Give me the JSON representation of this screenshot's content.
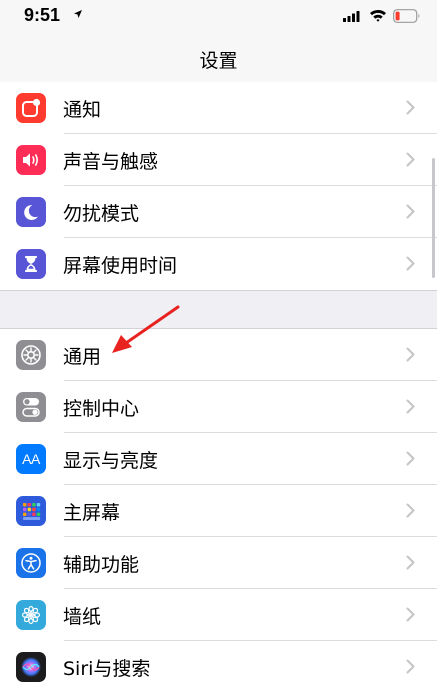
{
  "status_bar": {
    "time": "9:51"
  },
  "nav": {
    "title": "设置"
  },
  "groups": [
    {
      "items": [
        {
          "label": "通知",
          "icon": "notifications-icon",
          "color": "#ff3b30"
        },
        {
          "label": "声音与触感",
          "icon": "sound-icon",
          "color": "#ff2d55"
        },
        {
          "label": "勿扰模式",
          "icon": "moon-icon",
          "color": "#5856d6"
        },
        {
          "label": "屏幕使用时间",
          "icon": "hourglass-icon",
          "color": "#5856d6"
        }
      ]
    },
    {
      "items": [
        {
          "label": "通用",
          "icon": "gear-icon",
          "color": "#8e8e93"
        },
        {
          "label": "控制中心",
          "icon": "toggles-icon",
          "color": "#8e8e93"
        },
        {
          "label": "显示与亮度",
          "icon": "text-size-icon",
          "color": "#007aff"
        },
        {
          "label": "主屏幕",
          "icon": "home-grid-icon",
          "color": "#2d5bdc"
        },
        {
          "label": "辅助功能",
          "icon": "accessibility-icon",
          "color": "#1a73e8"
        },
        {
          "label": "墙纸",
          "icon": "flower-icon",
          "color": "#34aadc"
        },
        {
          "label": "Siri与搜索",
          "icon": "siri-icon",
          "color": "#1c1c1e"
        }
      ]
    }
  ],
  "icon_text": {
    "display": "AA"
  },
  "colors": {
    "chevron": "#c4c4c7",
    "annotation_arrow": "#e8231f",
    "separator": "#d1d1d6"
  }
}
